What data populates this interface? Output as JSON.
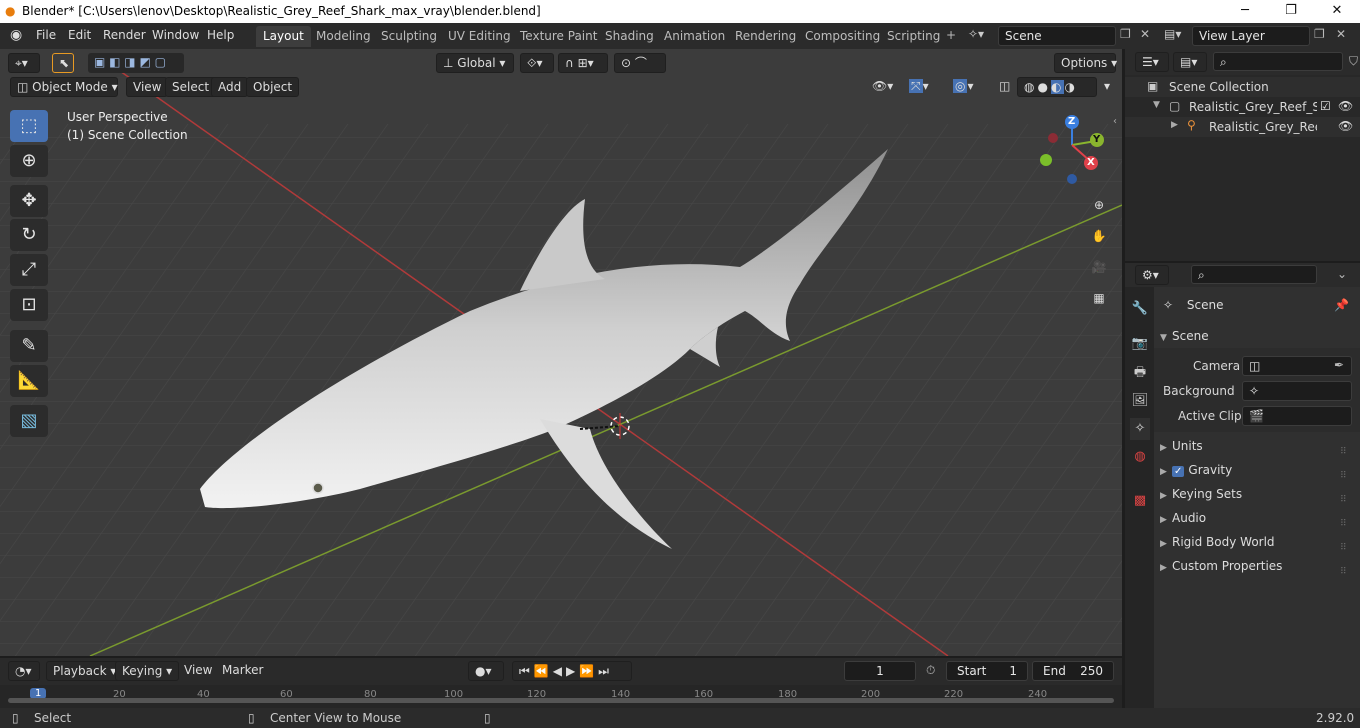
{
  "window": {
    "title": "Blender* [C:\\Users\\lenov\\Desktop\\Realistic_Grey_Reef_Shark_max_vray\\blender.blend]",
    "min": "─",
    "max": "❐",
    "close": "✕"
  },
  "menubar": {
    "file": "File",
    "edit": "Edit",
    "render": "Render",
    "window": "Window",
    "help": "Help"
  },
  "workspaces": [
    "Layout",
    "Modeling",
    "Sculpting",
    "UV Editing",
    "Texture Paint",
    "Shading",
    "Animation",
    "Rendering",
    "Compositing",
    "Scripting"
  ],
  "scene": {
    "name": "Scene",
    "view_layer": "View Layer"
  },
  "viewport": {
    "mode": "Object Mode",
    "menu_view": "View",
    "menu_select": "Select",
    "menu_add": "Add",
    "menu_object": "Object",
    "transform": "Global",
    "options": "Options",
    "overlay_line1": "User Perspective",
    "overlay_line2": "(1) Scene Collection",
    "gizmo": {
      "z": "Z",
      "y": "Y",
      "x": "X"
    }
  },
  "outliner": {
    "root": "Scene Collection",
    "collection": "Realistic_Grey_Reef_Sha",
    "object": "Realistic_Grey_Reef_"
  },
  "properties": {
    "header": "Scene",
    "panel": "Scene",
    "camera_label": "Camera",
    "background_label": "Background ...",
    "clip_label": "Active Clip",
    "sections": [
      "Units",
      "Gravity",
      "Keying Sets",
      "Audio",
      "Rigid Body World",
      "Custom Properties"
    ]
  },
  "timeline": {
    "playback": "Playback",
    "keying": "Keying",
    "view": "View",
    "marker": "Marker",
    "current_frame": "1",
    "start_label": "Start",
    "start": "1",
    "end_label": "End",
    "end": "250",
    "ruler": [
      "20",
      "40",
      "60",
      "80",
      "100",
      "120",
      "140",
      "160",
      "180",
      "200",
      "220",
      "240"
    ],
    "ruler_current": "1"
  },
  "status": {
    "left": "Select",
    "middle": "Center View to Mouse",
    "version": "2.92.0"
  },
  "colors": {
    "accent": "#4772b3",
    "x_axis": "#b03a3a",
    "y_axis": "#7a9a2e",
    "grid": "#464646"
  }
}
